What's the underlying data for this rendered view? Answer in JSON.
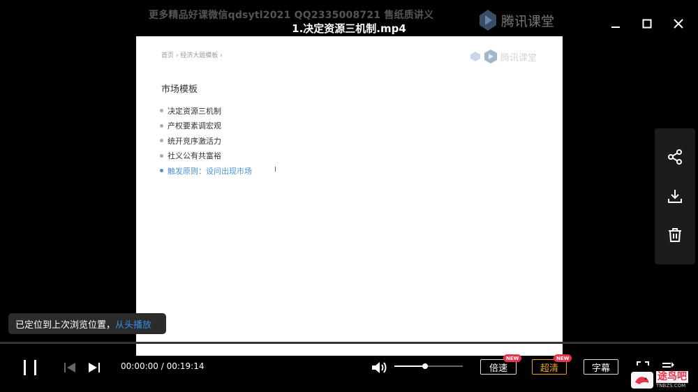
{
  "header": {
    "watermark": "更多精品好课微信qdsytl2021 QQ2335008721 售纸质讲义",
    "title": "1.决定资源三机制.mp4",
    "brand": "腾讯课堂"
  },
  "slide": {
    "breadcrumb": "首页 › 经济大题模板 ›",
    "brand": "腾讯课堂",
    "title": "市场模板",
    "bullets": [
      "决定资源三机制",
      "产权要素调宏观",
      "统开竞序激活力",
      "社义公有共富裕",
      "触发原则：设问出现市场"
    ]
  },
  "toast": {
    "text": "已定位到上次浏览位置，",
    "link": "从头播放"
  },
  "controls": {
    "current_time": "00:00:00",
    "separator": " / ",
    "total_time": "00:19:14",
    "volume": 0.45,
    "progress": 0.0,
    "speed_label": "倍速",
    "quality_label": "超清",
    "subtitle_label": "字幕",
    "badge_new": "NEW",
    "accent_color": "#f0a020"
  },
  "site_logo": {
    "text": "途鸟吧",
    "subtext": "TNBZS.COM"
  }
}
